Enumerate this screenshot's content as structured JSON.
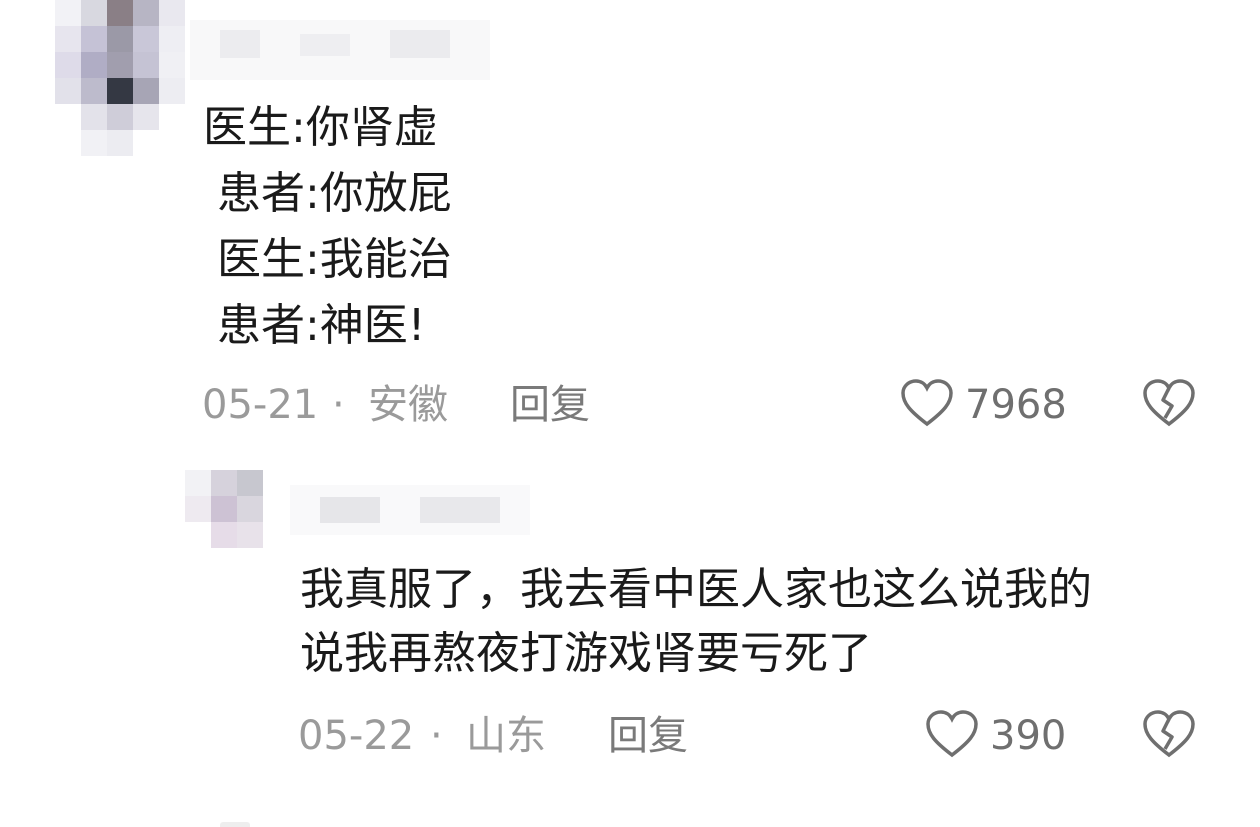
{
  "comments": [
    {
      "lines": [
        "医生:你肾虚",
        " 患者:你放屁",
        " 医生:我能治",
        " 患者:神医!"
      ],
      "date": "05-21",
      "separator": "·",
      "location": "安徽",
      "reply_label": "回复",
      "likes": "7968"
    },
    {
      "lines": [
        "我真服了，我去看中医人家也这么说我的",
        "说我再熬夜打游戏肾要亏死了"
      ],
      "date": "05-22",
      "separator": "·",
      "location": "山东",
      "reply_label": "回复",
      "likes": "390"
    }
  ],
  "colors": {
    "meta_gray": "#9a9a9a",
    "text": "#1a1a1a",
    "icon_gray": "#6f6f6f"
  }
}
